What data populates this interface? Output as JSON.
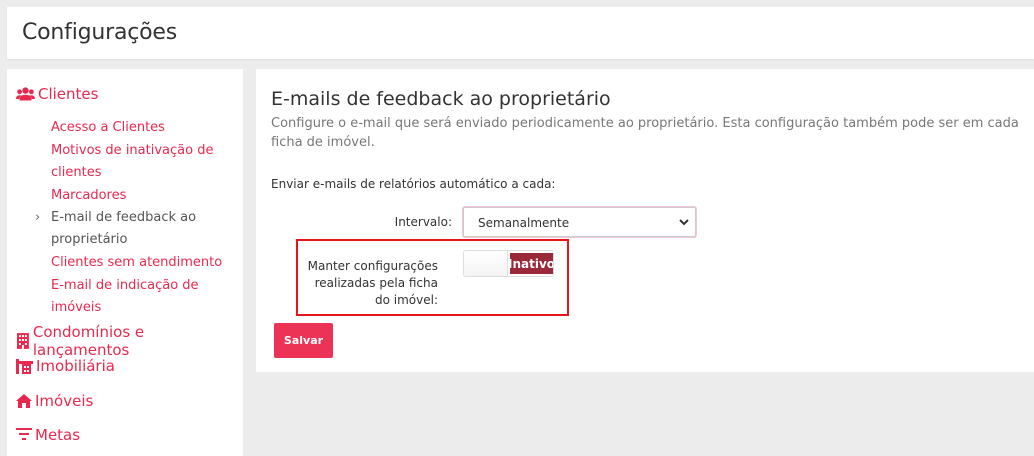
{
  "header": {
    "title": "Configurações"
  },
  "sidebar": {
    "clientes": {
      "label": "Clientes",
      "items": [
        "Acesso a Clientes",
        "Motivos de inativação de clientes",
        "Marcadores",
        "E-mail de feedback ao proprietário",
        "Clientes sem atendimento",
        "E-mail de indicação de imóveis"
      ]
    },
    "sections": [
      "Condomínios e lançamentos",
      "Imobiliária",
      "Imóveis",
      "Metas"
    ]
  },
  "panel": {
    "title": "E-mails de feedback ao proprietário",
    "description": "Configure o e-mail que será enviado periodicamente ao proprietário. Esta configuração também pode ser em cada ficha de imóvel.",
    "send_label": "Enviar e-mails de relatórios automático a cada:",
    "interval_label": "Intervalo:",
    "interval_value": "Semanalmente",
    "keep_label": "Manter configurações realizadas pela ficha do imóvel:",
    "toggle_state": "Inativo",
    "save_label": "Salvar"
  },
  "colors": {
    "accent": "#e8294f",
    "toggle_off": "#9a2a3a",
    "highlight_border": "#e8141c"
  }
}
